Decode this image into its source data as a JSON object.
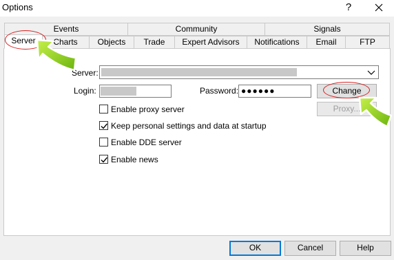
{
  "window": {
    "title": "Options",
    "help_label": "?"
  },
  "tabs": {
    "row1": [
      {
        "label": "Events"
      },
      {
        "label": "Community"
      },
      {
        "label": "Signals"
      }
    ],
    "row2": [
      {
        "label": "Server",
        "active": true
      },
      {
        "label": "Charts"
      },
      {
        "label": "Objects"
      },
      {
        "label": "Trade"
      },
      {
        "label": "Expert Advisors"
      },
      {
        "label": "Notifications"
      },
      {
        "label": "Email"
      },
      {
        "label": "FTP"
      }
    ]
  },
  "server_tab": {
    "server_label": "Server:",
    "server_value": "",
    "login_label": "Login:",
    "login_value": "",
    "password_label": "Password:",
    "password_value": "●●●●●●",
    "change_button": "Change",
    "proxy_button": "Proxy...",
    "checkboxes": [
      {
        "label": "Enable proxy server",
        "checked": false
      },
      {
        "label": "Keep personal settings and data at startup",
        "checked": true
      },
      {
        "label": "Enable DDE server",
        "checked": false
      },
      {
        "label": "Enable news",
        "checked": true
      }
    ]
  },
  "footer": {
    "ok_label": "OK",
    "cancel_label": "Cancel",
    "help_label": "Help"
  },
  "colors": {
    "annotation_ring": "#d62020",
    "arrow_green": "#8fd11a",
    "panel_bg": "#ffffff",
    "dialog_bg": "#f0f0f0"
  },
  "icons": {
    "close": "close-icon",
    "help": "help-icon",
    "dropdown": "chevron-down-icon",
    "pointer": "green-arrow-icon"
  }
}
